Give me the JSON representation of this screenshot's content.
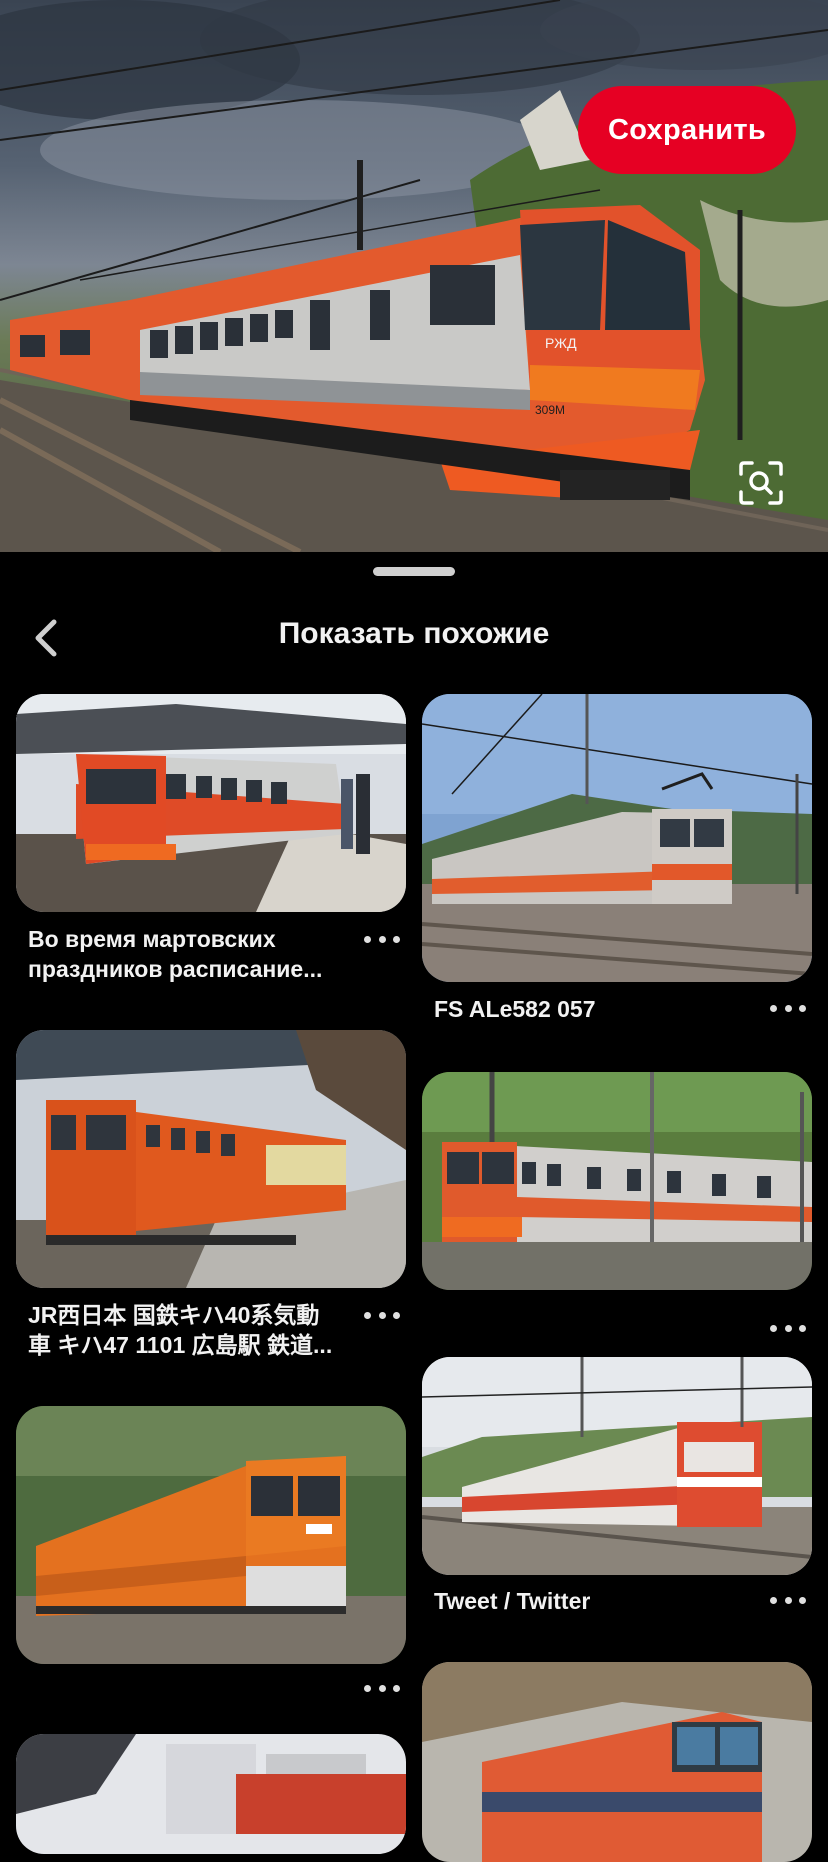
{
  "hero": {
    "save_label": "Сохранить",
    "visual_search_icon": "visual-search-icon"
  },
  "sheet": {
    "title": "Показать похожие",
    "back_icon": "chevron-left-icon"
  },
  "pins": [
    {
      "caption_lines": [
        "Во время мартовских",
        "праздников расписание..."
      ]
    },
    {
      "caption_lines": [
        "FS ALe582 057"
      ]
    },
    {
      "caption_lines": [
        "JR西日本 国鉄キハ40系気動",
        "車 キハ47 1101 広島駅 鉄道..."
      ]
    },
    {
      "caption_lines": []
    },
    {
      "caption_lines": [
        "Tweet / Twitter"
      ]
    },
    {
      "caption_lines": []
    },
    {
      "caption_lines": []
    },
    {
      "caption_lines": []
    }
  ],
  "colors": {
    "accent": "#e60023",
    "background": "#000000",
    "text": "#f2f2f2"
  }
}
